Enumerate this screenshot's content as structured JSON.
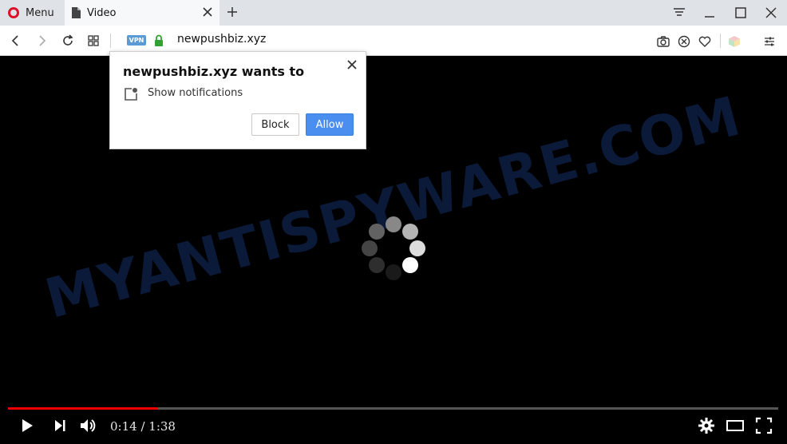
{
  "browser": {
    "menu_label": "Menu",
    "tab_title": "Video",
    "vpn_badge": "VPN",
    "url": "newpushbiz.xyz"
  },
  "video": {
    "watermark": "MYANTISPYWARE.COM",
    "time_display": "0:14 / 1:38",
    "progress_percent": 19.5
  },
  "popup": {
    "title": "newpushbiz.xyz wants to",
    "permission": "Show notifications",
    "block_label": "Block",
    "allow_label": "Allow"
  },
  "colors": {
    "accent_blue": "#4a8ff0",
    "progress_red": "#ee0000",
    "opera_red": "#e0102a",
    "vpn_blue": "#5b9bd5",
    "lock_green": "#2fa32f"
  },
  "icons": [
    "opera-logo-icon",
    "document-icon",
    "close-icon",
    "plus-icon",
    "filter-icon",
    "minimize-icon",
    "maximize-icon",
    "back-icon",
    "forward-icon",
    "reload-icon",
    "grid-icon",
    "lock-icon",
    "camera-icon",
    "block-ads-icon",
    "heart-icon",
    "cube-icon",
    "settings-sliders-icon",
    "play-icon",
    "next-icon",
    "volume-icon",
    "gear-icon",
    "theater-icon",
    "fullscreen-icon"
  ]
}
